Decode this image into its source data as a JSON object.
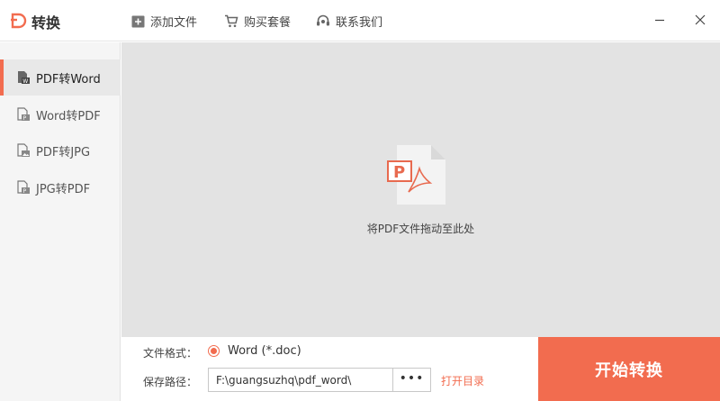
{
  "app": {
    "title": "转换",
    "accent_color": "#f26c4f"
  },
  "toolbar": {
    "add_file": "添加文件",
    "buy_plan": "购买套餐",
    "contact_us": "联系我们"
  },
  "sidebar": {
    "items": [
      {
        "label": "PDF转Word",
        "icon": "word-doc-icon",
        "active": true
      },
      {
        "label": "Word转PDF",
        "icon": "pdf-doc-icon",
        "active": false
      },
      {
        "label": "PDF转JPG",
        "icon": "image-doc-icon",
        "active": false
      },
      {
        "label": "JPG转PDF",
        "icon": "pdf-doc-icon",
        "active": false
      }
    ]
  },
  "dropzone": {
    "hint": "将PDF文件拖动至此处",
    "icon": "pdf-file-icon"
  },
  "settings": {
    "format_label": "文件格式：",
    "format_option": "Word (*.doc)",
    "path_label": "保存路径：",
    "path_value": "F:\\guangsuzhq\\pdf_word\\",
    "browse_label": "•••",
    "open_dir_label": "打开目录"
  },
  "start_button": {
    "label": "开始转换"
  }
}
